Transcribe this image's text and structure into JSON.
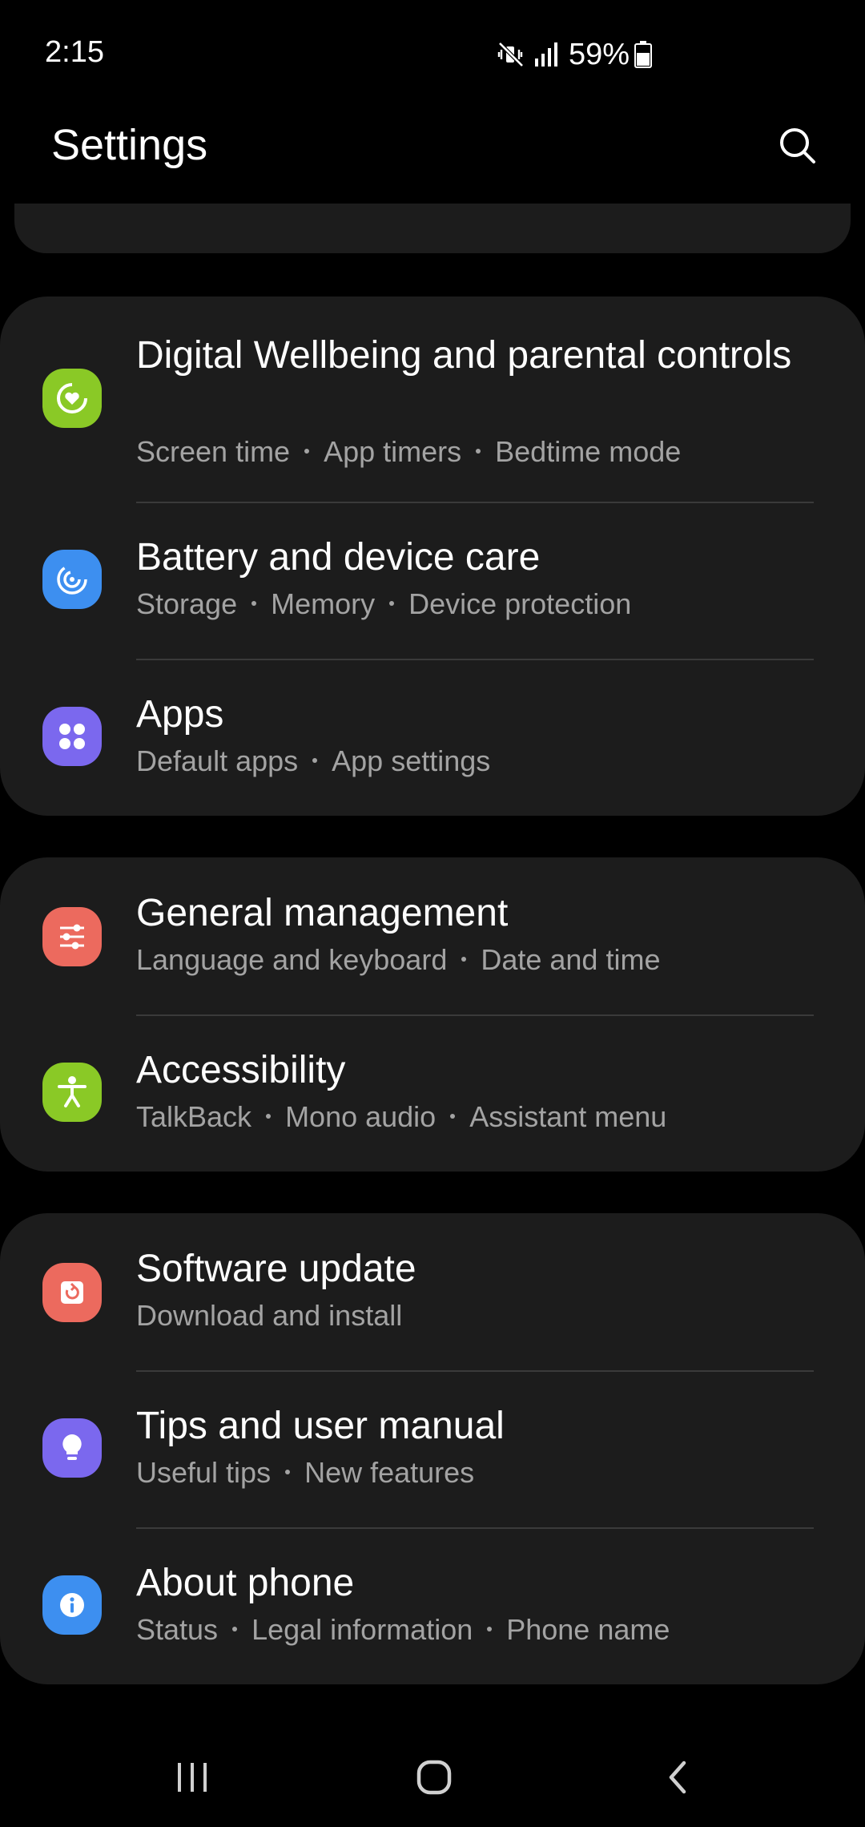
{
  "status_bar": {
    "time": "2:15",
    "battery_percent": "59%",
    "icons": [
      "mute-vibrate-icon",
      "signal-icon",
      "battery-icon"
    ]
  },
  "header": {
    "title": "Settings",
    "search_icon": "search-icon"
  },
  "colors": {
    "background": "#000000",
    "card": "#1c1c1c",
    "title_text": "#ffffff",
    "subtitle_text": "#a3a3a3",
    "divider": "#3a3a3a"
  },
  "groups": [
    {
      "items": [
        {
          "title": "Digital Wellbeing and parental controls",
          "subs": [
            "Screen time",
            "App timers",
            "Bedtime mode"
          ],
          "icon": "digital-wellbeing-icon",
          "color": "#8ac926"
        },
        {
          "title": "Battery and device care",
          "subs": [
            "Storage",
            "Memory",
            "Device protection"
          ],
          "icon": "device-care-icon",
          "color": "#3d8ff0"
        },
        {
          "title": "Apps",
          "subs": [
            "Default apps",
            "App settings"
          ],
          "icon": "apps-icon",
          "color": "#7b68ee"
        }
      ]
    },
    {
      "items": [
        {
          "title": "General management",
          "subs": [
            "Language and keyboard",
            "Date and time"
          ],
          "icon": "general-management-icon",
          "color": "#ec6a5e"
        },
        {
          "title": "Accessibility",
          "subs": [
            "TalkBack",
            "Mono audio",
            "Assistant menu"
          ],
          "icon": "accessibility-icon",
          "color": "#8ac926"
        }
      ]
    },
    {
      "items": [
        {
          "title": "Software update",
          "subs": [
            "Download and install"
          ],
          "icon": "software-update-icon",
          "color": "#ec6a5e"
        },
        {
          "title": "Tips and user manual",
          "subs": [
            "Useful tips",
            "New features"
          ],
          "icon": "lightbulb-icon",
          "color": "#7b68ee"
        },
        {
          "title": "About phone",
          "subs": [
            "Status",
            "Legal information",
            "Phone name"
          ],
          "icon": "info-icon",
          "color": "#3d8ff0"
        }
      ]
    }
  ],
  "nav_bar": {
    "recents_icon": "recents-icon",
    "home_icon": "home-icon",
    "back_icon": "back-icon"
  }
}
